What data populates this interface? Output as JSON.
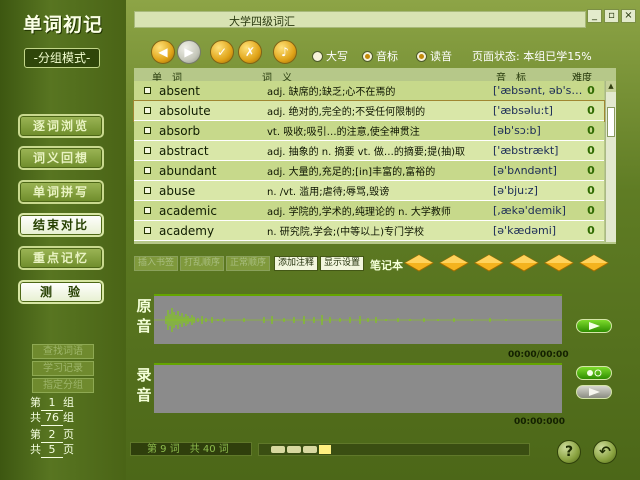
{
  "app": {
    "title": "单词初记",
    "mode": "-分组模式-",
    "window_title": "大学四级词汇"
  },
  "nav": [
    {
      "label": "逐词浏览",
      "active": false
    },
    {
      "label": "词义回想",
      "active": false
    },
    {
      "label": "单词拼写",
      "active": false
    },
    {
      "label": "结束对比",
      "active": true
    },
    {
      "label": "重点记忆",
      "active": false
    },
    {
      "label": "测　验",
      "active": true
    }
  ],
  "side_actions": [
    "查找词语",
    "学习记录",
    "指定分组"
  ],
  "pager": {
    "group_prefix": "第",
    "group_value": "1",
    "group_suffix": "组",
    "total_groups_prefix": "共",
    "total_groups_value": "76",
    "total_groups_suffix": "组",
    "page_prefix": "第",
    "page_value": "2",
    "page_suffix": "页",
    "total_pages_prefix": "共",
    "total_pages_value": "5",
    "total_pages_suffix": "页"
  },
  "toolbar": {
    "options": [
      {
        "label": "大写",
        "checked": false
      },
      {
        "label": "音标",
        "checked": true
      },
      {
        "label": "读音",
        "checked": true
      }
    ],
    "status": "页面状态: 本组已学15%"
  },
  "table": {
    "headers": {
      "word": "单　词",
      "meaning": "词　义",
      "phonetic": "音　标",
      "difficulty": "难度"
    },
    "rows": [
      {
        "word": "absent",
        "meaning": "adj. 缺席的;缺乏;心不在焉的",
        "phonetic": "['æbsənt, əb's…",
        "difficulty": "0"
      },
      {
        "word": "absolute",
        "meaning": "adj. 绝对的,完全的;不受任何限制的",
        "phonetic": "['æbsəlu:t]",
        "difficulty": "0"
      },
      {
        "word": "absorb",
        "meaning": "vt. 吸收;吸引…的注意,使全神贯注",
        "phonetic": "[əb'sɔ:b]",
        "difficulty": "0"
      },
      {
        "word": "abstract",
        "meaning": "adj. 抽象的 n. 摘要 vt. 做…的摘要;提(抽)取",
        "phonetic": "['æbstrækt]",
        "difficulty": "0"
      },
      {
        "word": "abundant",
        "meaning": "adj. 大量的,充足的;[in]丰富的,富裕的",
        "phonetic": "[ə'bʌndənt]",
        "difficulty": "0"
      },
      {
        "word": "abuse",
        "meaning": "n. /vt. 滥用;虐待;辱骂,毁谤",
        "phonetic": "[ə'bju:z]",
        "difficulty": "0"
      },
      {
        "word": "academic",
        "meaning": "adj. 学院的,学术的,纯理论的 n. 大学教师",
        "phonetic": "[,ækə'demik]",
        "difficulty": "0"
      },
      {
        "word": "academy",
        "meaning": "n. 研究院,学会;(中等以上)专门学校",
        "phonetic": "[ə'kædəmi]",
        "difficulty": "0"
      }
    ]
  },
  "notes": {
    "buttons": [
      {
        "label": "插入书签",
        "enabled": false
      },
      {
        "label": "打乱顺序",
        "enabled": false
      },
      {
        "label": "正常顺序",
        "enabled": false
      },
      {
        "label": "添加注释",
        "enabled": true
      },
      {
        "label": "显示设置",
        "enabled": true
      }
    ],
    "label": "笔记本"
  },
  "original": {
    "label": "原音",
    "time": "00:00/00:00"
  },
  "recording": {
    "label": "录音",
    "time": "00:00:000"
  },
  "footer": {
    "status": "第 9 词　共 40 词"
  },
  "colors": {
    "accent_gold": "#e0a419",
    "panel_green": "#5f7c24",
    "wave_green": "#7fd400"
  }
}
